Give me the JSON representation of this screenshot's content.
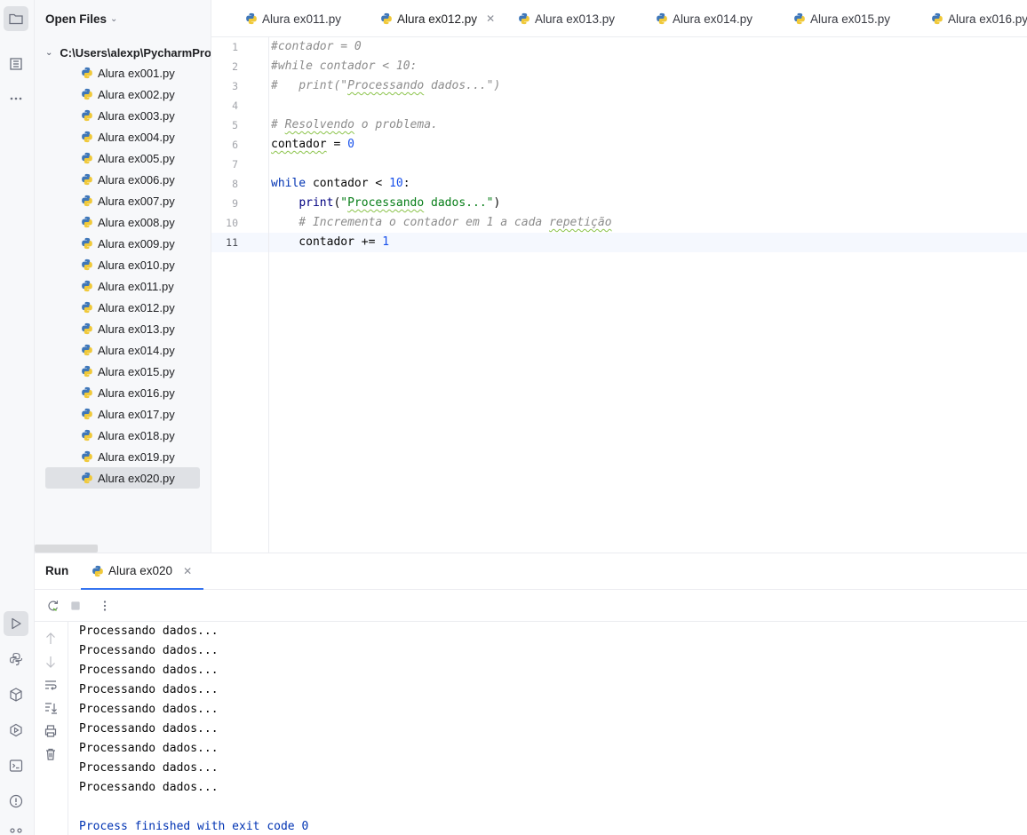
{
  "project": {
    "header_label": "Open Files",
    "root_path": "C:\\Users\\alexp\\PycharmProjects",
    "files": [
      "Alura ex001.py",
      "Alura ex002.py",
      "Alura ex003.py",
      "Alura ex004.py",
      "Alura ex005.py",
      "Alura ex006.py",
      "Alura ex007.py",
      "Alura ex008.py",
      "Alura ex009.py",
      "Alura ex010.py",
      "Alura ex011.py",
      "Alura ex012.py",
      "Alura ex013.py",
      "Alura ex014.py",
      "Alura ex015.py",
      "Alura ex016.py",
      "Alura ex017.py",
      "Alura ex018.py",
      "Alura ex019.py",
      "Alura ex020.py"
    ],
    "selected_file": "Alura ex020.py"
  },
  "tabs": [
    {
      "label": "Alura ex011.py"
    },
    {
      "label": "Alura ex012.py",
      "active": true
    },
    {
      "label": "Alura ex013.py"
    },
    {
      "label": "Alura ex014.py"
    },
    {
      "label": "Alura ex015.py"
    },
    {
      "label": "Alura ex016.py"
    }
  ],
  "editor": {
    "line_numbers": [
      "1",
      "2",
      "3",
      "4",
      "5",
      "6",
      "7",
      "8",
      "9",
      "10",
      "11"
    ],
    "current_line": "11",
    "lines": [
      "#contador = 0",
      "#while contador < 10:",
      "#   print(\"Processando dados...\")",
      "",
      "# Resolvendo o problema.",
      "contador = 0",
      "",
      "while contador < 10:",
      "    print(\"Processando dados...\")",
      "    # Incrementa o contador em 1 a cada repetição",
      "    contador += 1"
    ]
  },
  "run": {
    "title": "Run",
    "tab_label": "Alura ex020",
    "output": [
      "Processando dados...",
      "Processando dados...",
      "Processando dados...",
      "Processando dados...",
      "Processando dados...",
      "Processando dados...",
      "Processando dados...",
      "Processando dados...",
      "Processando dados...",
      "",
      "Process finished with exit code 0"
    ]
  },
  "icons": {
    "stripe_top": [
      "folder-icon",
      "structure-icon",
      "more-icon"
    ],
    "stripe_bottom": [
      "run-icon",
      "python-console-icon",
      "python-packages-icon",
      "services-icon",
      "terminal-icon",
      "problems-icon",
      "git-icon"
    ],
    "run_toolbar": [
      "rerun-icon",
      "stop-icon",
      "more-vertical-icon"
    ],
    "console_side": [
      "scroll-up-icon",
      "scroll-down-icon",
      "soft-wrap-icon",
      "scroll-to-end-icon",
      "print-icon",
      "clear-icon"
    ]
  },
  "colors": {
    "keyword": "#0033b3",
    "number": "#1750eb",
    "string": "#067d17",
    "comment": "#8c8c8c",
    "accent": "#3574f0"
  }
}
